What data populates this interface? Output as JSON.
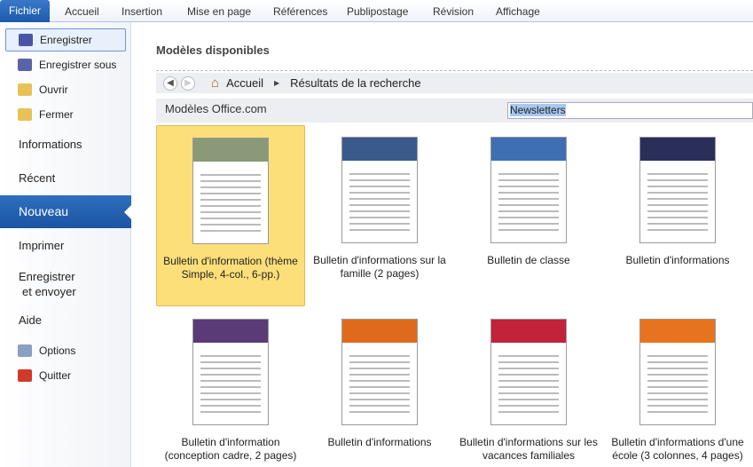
{
  "tabs": [
    "Fichier",
    "Accueil",
    "Insertion",
    "Mise en page",
    "Références",
    "Publipostage",
    "Révision",
    "Affichage"
  ],
  "sidebar": {
    "save": "Enregistrer",
    "save_as": "Enregistrer sous",
    "open": "Ouvrir",
    "close": "Fermer",
    "info": "Informations",
    "recent": "Récent",
    "new": "Nouveau",
    "print": "Imprimer",
    "send1": "Enregistrer",
    "send2": "et envoyer",
    "help": "Aide",
    "options": "Options",
    "quit": "Quitter"
  },
  "main": {
    "title": "Modèles disponibles",
    "breadcrumb": {
      "home": "Accueil",
      "current": "Résultats de la recherche"
    },
    "source": "Modèles Office.com",
    "search_value": "Newsletters",
    "templates": [
      {
        "label": "Bulletin d'information (thème Simple, 4-col., 6-pp.)",
        "color": "#8a9a78",
        "selected": true
      },
      {
        "label": "Bulletin d'informations sur la famille (2 pages)",
        "color": "#3b5a8c"
      },
      {
        "label": "Bulletin de classe",
        "color": "#3f6fb3"
      },
      {
        "label": "Bulletin d'informations",
        "color": "#2a2f5a"
      },
      {
        "label": "Bulletin d'information (conception cadre, 2 pages)",
        "color": "#5b3a78"
      },
      {
        "label": "Bulletin d'informations",
        "color": "#e06a1c"
      },
      {
        "label": "Bulletin d'informations sur les vacances familiales",
        "color": "#c2223a"
      },
      {
        "label": "Bulletin d'informations d'une école (3 colonnes, 4 pages)",
        "color": "#e8731e"
      }
    ]
  }
}
